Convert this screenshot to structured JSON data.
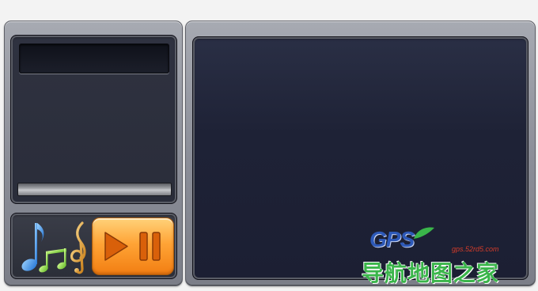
{
  "player": {
    "controls": {
      "play_pause_button": {
        "icon": "play-pause-icon",
        "accent": "#f7941d"
      },
      "music_notes_icon": "music-notes-icon"
    },
    "colors": {
      "frame": "#8c8f99",
      "panel_dark": "#1e2236",
      "button_orange": "#f7941d"
    }
  },
  "watermark": {
    "brand": "GPS",
    "url": "gps.52rd5.com",
    "tagline": "导航地图之家",
    "brand_color": "#2d59b8",
    "tagline_color": "#3ab54a"
  }
}
